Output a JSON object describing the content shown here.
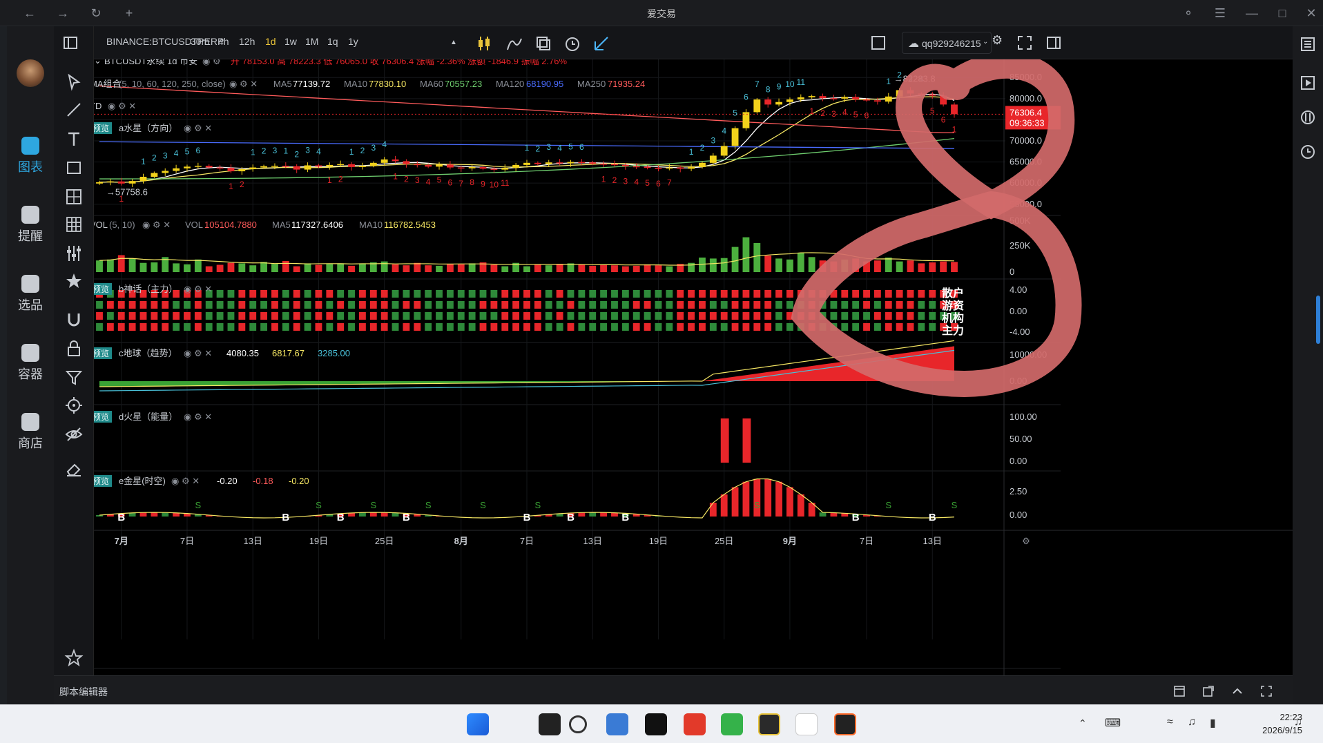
{
  "window": {
    "title": "爱交易"
  },
  "nav": [
    {
      "label": "图表",
      "icon": "chart-icon",
      "active": true
    },
    {
      "label": "提醒",
      "icon": "bell-icon"
    },
    {
      "label": "选品",
      "icon": "search-chart-icon"
    },
    {
      "label": "容器",
      "icon": "container-icon"
    },
    {
      "label": "商店",
      "icon": "store-icon"
    }
  ],
  "toolbar": {
    "symbol": "BINANCE:BTCUSDTPERP",
    "timeframes": [
      "30m",
      "4h",
      "12h",
      "1d",
      "1w",
      "1M",
      "1q",
      "1y"
    ],
    "active_timeframe": "1d",
    "user": "qq929246215"
  },
  "legend": {
    "symbol": "BTCUSDT永续 1d 币安",
    "ohlc": "开 78153.0 高 78223.3 低 76065.0 收 76306.4 涨幅 -2.36% 涨额 -1846.9 振幅 2.76%",
    "ma_name": "MA组合",
    "ma_params": "(5, 10, 60, 120, 250, close)",
    "ma_values": [
      {
        "label": "MA5",
        "value": "77139.72",
        "color": "#ffffff"
      },
      {
        "label": "MA10",
        "value": "77830.10",
        "color": "#f5e663"
      },
      {
        "label": "MA60",
        "value": "70557.23",
        "color": "#6fcf6f"
      },
      {
        "label": "MA120",
        "value": "68190.95",
        "color": "#4a6cff"
      },
      {
        "label": "MA250",
        "value": "71935.24",
        "color": "#ff5b5b"
      }
    ],
    "td": "TD",
    "preview": "预览",
    "a_name": "a水星（方向）",
    "vol_name": "VOL",
    "vol_params": "(5, 10)",
    "vol_values": [
      {
        "label": "VOL",
        "value": "105104.7880",
        "color": "#ff5b5b"
      },
      {
        "label": "MA5",
        "value": "117327.6406",
        "color": "#ffffff"
      },
      {
        "label": "MA10",
        "value": "116782.5453",
        "color": "#f5e663"
      }
    ],
    "b_name": "b神话（主力）",
    "b_labels": [
      "散户",
      "游资",
      "机构",
      "主力"
    ],
    "c_name": "c地球（趋势）",
    "c_values": [
      {
        "v": "4080.35",
        "color": "#ffffff"
      },
      {
        "v": "6817.67",
        "color": "#f5e663"
      },
      {
        "v": "3285.00",
        "color": "#49c0d8"
      }
    ],
    "d_name": "d火星（能量）",
    "e_name": "e金星(时空)",
    "e_values": [
      {
        "v": "-0.20",
        "color": "#ffffff"
      },
      {
        "v": "-0.18",
        "color": "#ff5b5b"
      },
      {
        "v": "-0.20",
        "color": "#f5e663"
      }
    ]
  },
  "price_axis": [
    "85000.0",
    "80000.0",
    "75000.0",
    "70000.0",
    "65000.0",
    "60000.0",
    "55000.0"
  ],
  "last_price": "76306.4",
  "countdown": "09:36:33",
  "low_marker": "57758.6",
  "high_marker": "82283.8",
  "vol_axis": [
    "500K",
    "250K",
    "0"
  ],
  "b_axis": [
    "4.00",
    "0.00",
    "-4.00"
  ],
  "c_axis": [
    "10000.00",
    "0.00"
  ],
  "d_axis": [
    "100.00",
    "50.00",
    "0.00"
  ],
  "e_axis": [
    "2.50",
    "0.00"
  ],
  "date_axis": [
    {
      "t": "7月",
      "bold": true
    },
    {
      "t": "7日"
    },
    {
      "t": "13日"
    },
    {
      "t": "19日"
    },
    {
      "t": "25日"
    },
    {
      "t": "8月",
      "bold": true
    },
    {
      "t": "7日"
    },
    {
      "t": "13日"
    },
    {
      "t": "19日"
    },
    {
      "t": "25日"
    },
    {
      "t": "9月",
      "bold": true
    },
    {
      "t": "7日"
    },
    {
      "t": "13日"
    }
  ],
  "bottom": {
    "label": "脚本编辑器"
  },
  "clock": {
    "time": "22:23",
    "date": "2026/9/15"
  },
  "chart_data": {
    "type": "candlestick",
    "xlabel": "",
    "ylabel": "",
    "ylim": [
      53000,
      87000
    ],
    "x": [
      "6/29",
      "6/30",
      "7/1",
      "7/2",
      "7/3",
      "7/4",
      "7/5",
      "7/6",
      "7/7",
      "7/8",
      "7/9",
      "7/10",
      "7/11",
      "7/12",
      "7/13",
      "7/14",
      "7/15",
      "7/16",
      "7/17",
      "7/18",
      "7/19",
      "7/20",
      "7/21",
      "7/22",
      "7/23",
      "7/24",
      "7/25",
      "7/26",
      "7/27",
      "7/28",
      "7/29",
      "7/30",
      "7/31",
      "8/1",
      "8/2",
      "8/3",
      "8/4",
      "8/5",
      "8/6",
      "8/7",
      "8/8",
      "8/9",
      "8/10",
      "8/11",
      "8/12",
      "8/13",
      "8/14",
      "8/15",
      "8/16",
      "8/17",
      "8/18",
      "8/19",
      "8/20",
      "8/21",
      "8/22",
      "8/23",
      "8/24",
      "8/25",
      "8/26",
      "8/27",
      "8/28",
      "8/29",
      "8/30",
      "8/31",
      "9/1",
      "9/2",
      "9/3",
      "9/4",
      "9/5",
      "9/6",
      "9/7",
      "9/8",
      "9/9",
      "9/10",
      "9/11",
      "9/12",
      "9/13",
      "9/14",
      "9/15"
    ],
    "close": [
      60200,
      60400,
      59900,
      60500,
      61500,
      62400,
      62900,
      63500,
      63900,
      64100,
      63700,
      63600,
      62800,
      63300,
      63700,
      64000,
      64100,
      64000,
      63200,
      64200,
      63900,
      64300,
      64500,
      63800,
      64100,
      64800,
      65600,
      65200,
      64500,
      64300,
      63900,
      64400,
      63700,
      63500,
      63800,
      63400,
      63200,
      63600,
      64300,
      64800,
      64500,
      64900,
      64700,
      65000,
      64900,
      64600,
      64500,
      64300,
      64000,
      63900,
      63600,
      63500,
      63700,
      63400,
      63800,
      64800,
      66500,
      68800,
      73000,
      76800,
      79800,
      78600,
      79200,
      79800,
      80300,
      80600,
      80100,
      80000,
      80400,
      79800,
      79600,
      79300,
      80500,
      82000,
      81200,
      81000,
      80700,
      78600,
      76306
    ],
    "volume": [
      120,
      130,
      175,
      140,
      95,
      100,
      155,
      90,
      80,
      130,
      60,
      75,
      95,
      90,
      70,
      105,
      85,
      115,
      60,
      90,
      75,
      85,
      90,
      65,
      90,
      100,
      110,
      80,
      70,
      95,
      70,
      65,
      85,
      80,
      90,
      100,
      75,
      60,
      95,
      60,
      80,
      70,
      85,
      90,
      75,
      65,
      80,
      70,
      60,
      65,
      80,
      70,
      60,
      85,
      95,
      150,
      140,
      145,
      260,
      360,
      300,
      170,
      140,
      130,
      200,
      155,
      120,
      110,
      130,
      140,
      110,
      120,
      150,
      110,
      120,
      90,
      100,
      110,
      105
    ],
    "tick_labels": [
      "7月",
      "7日",
      "13日",
      "19日",
      "25日",
      "8月",
      "7日",
      "13日",
      "19日",
      "25日",
      "9月",
      "7日",
      "13日"
    ],
    "series": [
      {
        "name": "MA5",
        "last": 77139.72
      },
      {
        "name": "MA10",
        "last": 77830.1
      },
      {
        "name": "MA60",
        "last": 70557.23
      },
      {
        "name": "MA120",
        "last": 68190.95
      },
      {
        "name": "MA250",
        "last": 71935.24
      }
    ]
  }
}
